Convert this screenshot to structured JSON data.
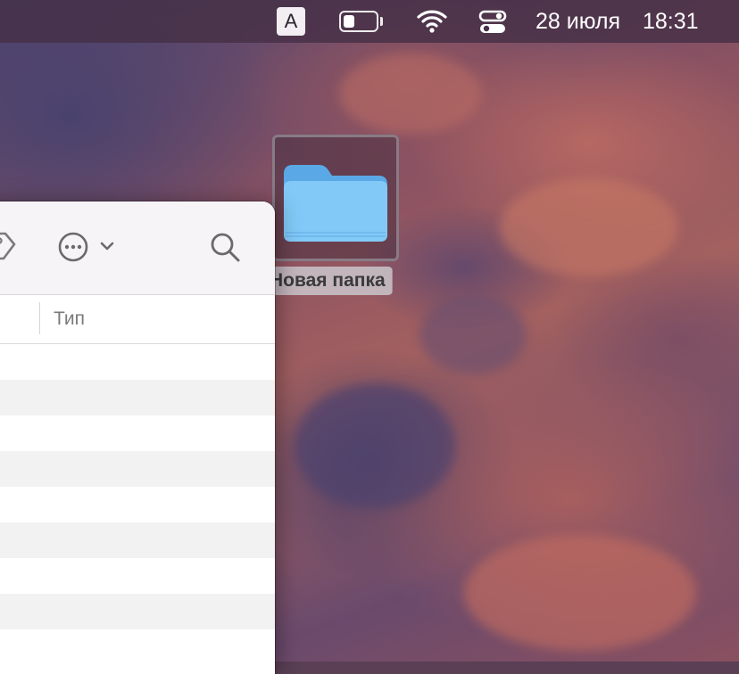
{
  "menubar": {
    "input_source": "A",
    "date": "28 июля",
    "time": "18:31",
    "icons": [
      "battery-icon",
      "wifi-icon",
      "control-center-icon"
    ],
    "battery_level": 0.3
  },
  "finder": {
    "toolbar": {
      "icons": [
        "tag-icon",
        "more-actions-icon",
        "chevron-down-icon",
        "search-icon"
      ]
    },
    "columns": {
      "type_label": "Тип"
    },
    "row_count": 9
  },
  "desktop": {
    "folder_label": "Новая папка",
    "folder_icon": "folder-icon",
    "colors": {
      "folder_blue": "#7cc4f5",
      "folder_tab": "#5aa9e6",
      "menubar": "#46304a"
    }
  }
}
